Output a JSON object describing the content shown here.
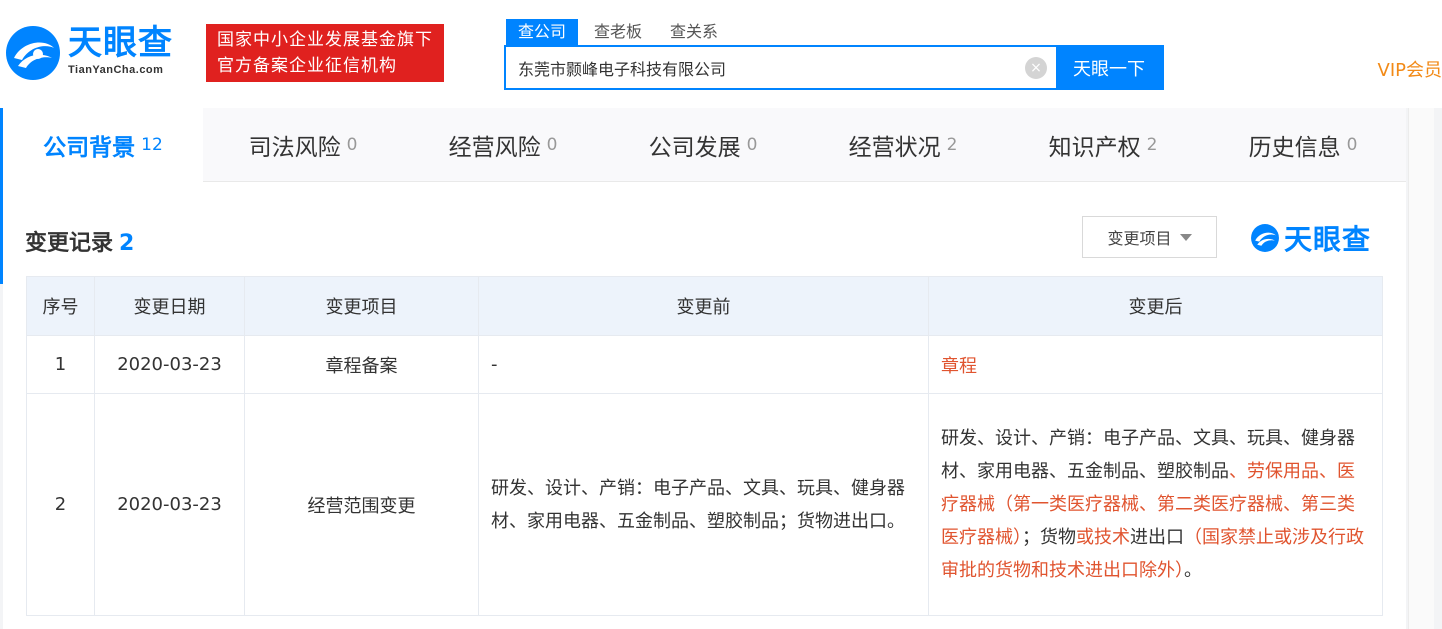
{
  "brand": {
    "logo_cn": "天眼查",
    "logo_en": "TianYanCha.com",
    "badge_line1": "国家中小企业发展基金旗下",
    "badge_line2": "官方备案企业征信机构"
  },
  "search": {
    "tabs": [
      "查公司",
      "查老板",
      "查关系"
    ],
    "active_tab": 0,
    "value": "东莞市颢峰电子科技有限公司",
    "button_label": "天眼一下",
    "clear_icon": "×"
  },
  "vip_label": "VIP会员",
  "nav_tabs": [
    {
      "label": "公司背景",
      "count": "12"
    },
    {
      "label": "司法风险",
      "count": "0"
    },
    {
      "label": "经营风险",
      "count": "0"
    },
    {
      "label": "公司发展",
      "count": "0"
    },
    {
      "label": "经营状况",
      "count": "2"
    },
    {
      "label": "知识产权",
      "count": "2"
    },
    {
      "label": "历史信息",
      "count": "0"
    }
  ],
  "section": {
    "title": "变更记录",
    "count": "2",
    "filter_label": "变更项目",
    "watermark": "天眼查"
  },
  "table": {
    "headers": [
      "序号",
      "变更日期",
      "变更项目",
      "变更前",
      "变更后"
    ],
    "rows": [
      {
        "index": "1",
        "date": "2020-03-23",
        "item": "章程备案",
        "before": "-",
        "after_segments": [
          {
            "text": "章程",
            "highlight": true
          }
        ]
      },
      {
        "index": "2",
        "date": "2020-03-23",
        "item": "经营范围变更",
        "before": "研发、设计、产销：电子产品、文具、玩具、健身器材、家用电器、五金制品、塑胶制品；货物进出口。",
        "after_segments": [
          {
            "text": "研发、设计、产销：电子产品、文具、玩具、健身器材、家用电器、五金制品、塑胶制品",
            "highlight": false
          },
          {
            "text": "、劳保用品、医疗器械（第一类医疗器械、第二类医疗器械、第三类医疗器械）",
            "highlight": true
          },
          {
            "text": "；货物",
            "highlight": false
          },
          {
            "text": "或技术",
            "highlight": true
          },
          {
            "text": "进出口",
            "highlight": false
          },
          {
            "text": "（国家禁止或涉及行政审批的货物和技术进出口除外）",
            "highlight": true
          },
          {
            "text": "。",
            "highlight": false
          }
        ]
      }
    ]
  },
  "colors": {
    "brand_blue": "#0084ff",
    "badge_red": "#e0211f",
    "highlight_red": "#e0542f",
    "vip_orange": "#f28a17"
  }
}
